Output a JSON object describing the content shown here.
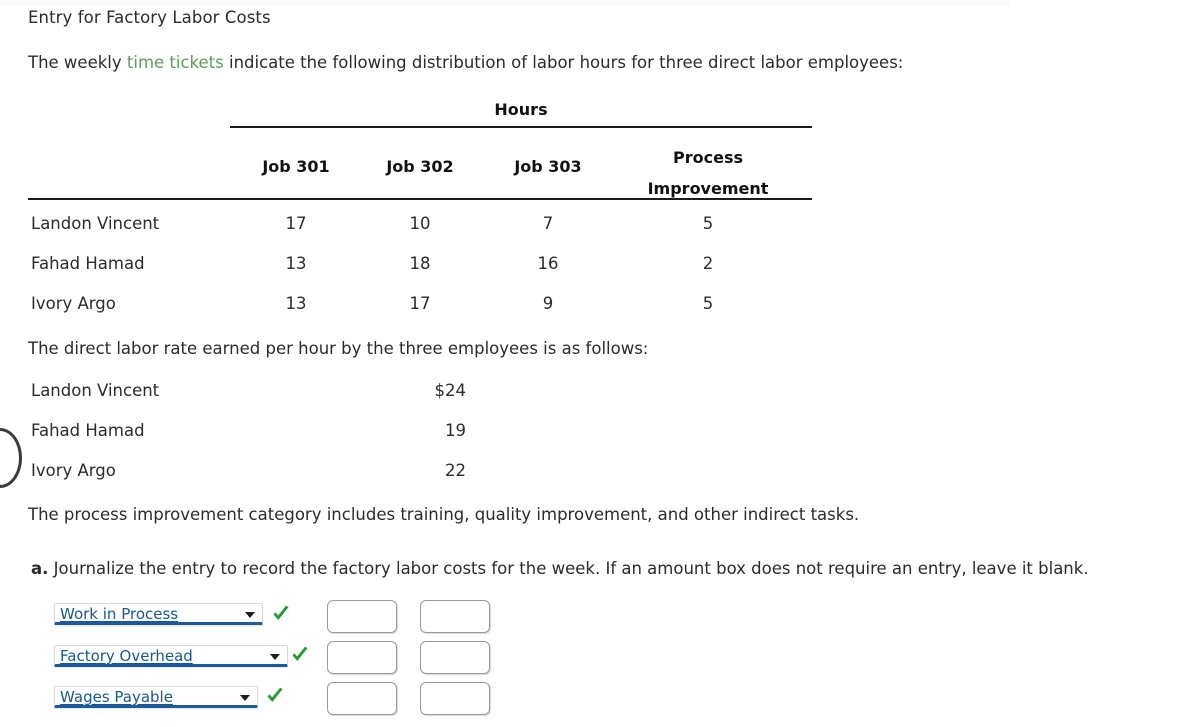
{
  "page": {
    "title": "Entry for Factory Labor Costs",
    "intro_before": "The weekly ",
    "intro_link": "time tickets",
    "intro_after": " indicate the following distribution of labor hours for three direct labor employees:",
    "rate_intro": "The direct labor rate earned per hour by the three employees is as follows:",
    "process_note": "The process improvement category includes training, quality improvement, and other indirect tasks.",
    "question_marker": "a.",
    "question_text": " Journalize the entry to record the factory labor costs for the week. If an amount box does not require an entry, leave it blank."
  },
  "hours_table": {
    "group_header": "Hours",
    "columns": [
      "Job 301",
      "Job 302",
      "Job 303",
      "Process Improvement"
    ],
    "column4_line1": "Process",
    "column4_line2": "Improvement",
    "rows": [
      {
        "name": "Landon Vincent",
        "values": [
          "17",
          "10",
          "7",
          "5"
        ]
      },
      {
        "name": "Fahad Hamad",
        "values": [
          "13",
          "18",
          "16",
          "2"
        ]
      },
      {
        "name": "Ivory Argo",
        "values": [
          "13",
          "17",
          "9",
          "5"
        ]
      }
    ]
  },
  "rate_table": {
    "rows": [
      {
        "name": "Landon Vincent",
        "rate": "$24"
      },
      {
        "name": "Fahad Hamad",
        "rate": "19"
      },
      {
        "name": "Ivory Argo",
        "rate": "22"
      }
    ]
  },
  "journal": {
    "rows": [
      {
        "account": "Work in Process",
        "debit": "",
        "credit": ""
      },
      {
        "account": "Factory Overhead",
        "debit": "",
        "credit": ""
      },
      {
        "account": "Wages Payable",
        "debit": "",
        "credit": ""
      }
    ],
    "account_options": [
      "Work in Process",
      "Factory Overhead",
      "Wages Payable"
    ],
    "check_mark": "✓"
  },
  "colors": {
    "link_green": "#5d9c5d",
    "check_green": "#2a9b34",
    "dropdown_blue": "#18588f",
    "dropdown_underline": "#1c5c9e",
    "rule_black": "#1b1b1b"
  }
}
